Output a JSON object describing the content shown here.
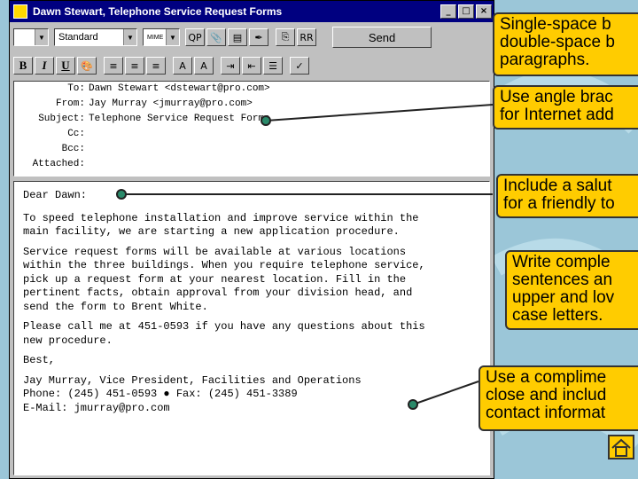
{
  "window": {
    "title": "Dawn Stewart, Telephone Service Request Forms",
    "controls": [
      "_",
      "□",
      "×"
    ]
  },
  "toolbar1": {
    "style_value": "Standard",
    "mime_label": "MIME",
    "qp_label": "QP",
    "rr_label": "RR",
    "send_label": "Send"
  },
  "toolbar2": {
    "bold": "B",
    "italic": "I",
    "underline": "U"
  },
  "headers": [
    {
      "label": "To:",
      "value": "Dawn Stewart <dstewart@pro.com>"
    },
    {
      "label": "From:",
      "value": "Jay Murray <jmurray@pro.com>"
    },
    {
      "label": "Subject:",
      "value": "Telephone Service Request Forms"
    },
    {
      "label": "Cc:",
      "value": ""
    },
    {
      "label": "Bcc:",
      "value": ""
    },
    {
      "label": "Attached:",
      "value": ""
    }
  ],
  "body": {
    "salutation": "Dear Dawn:",
    "p1": "To speed telephone installation and improve service within the\nmain facility, we are starting a new application procedure.",
    "p2": "Service request forms will be available at various locations\nwithin the three buildings. When you require telephone service,\npick up a request form at your nearest location. Fill in the\npertinent facts, obtain approval from your division head, and\nsend the form to Brent White.",
    "p3": "Please call me at 451-0593 if you have any questions about this\nnew procedure.",
    "closing": "Best,",
    "signature": "Jay Murray, Vice President, Facilities and Operations\nPhone: (245) 451-0593 ● Fax: (245) 451-3389\nE-Mail: jmurray@pro.com"
  },
  "callouts": [
    {
      "text": "Single-space b\ndouble-space b\nparagraphs."
    },
    {
      "text": "Use angle brac\nfor Internet add"
    },
    {
      "text": "Include a salut\nfor a friendly to"
    },
    {
      "text": "Write comple\nsentences an\nupper and lov\ncase letters."
    },
    {
      "text": "Use a complime\nclose and includ\ncontact informat"
    }
  ],
  "colors": {
    "callout": "#ffcc00",
    "titlebar": "#000080",
    "background": "#9bc6d8"
  },
  "icons": [
    "home-icon"
  ]
}
